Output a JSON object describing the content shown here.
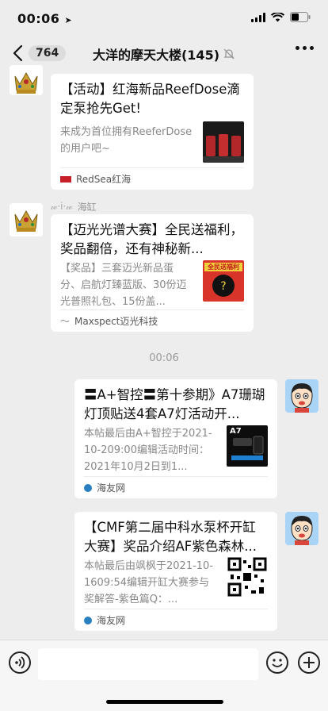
{
  "status_bar": {
    "time": "00:06"
  },
  "header": {
    "back_badge": "764",
    "title": "大洋的摩天大楼(145)"
  },
  "timestamp": "00:06",
  "messages": [
    {
      "title": "【活动】红海新品ReefDose滴定泵抢先Get!",
      "desc": "来成为首位拥有ReeferDose的用户吧~",
      "source": "RedSea红海"
    },
    {
      "nickname": "海缸",
      "title": "【迈光光谱大赛】全民送福利，奖品翻倍，还有神秘新...",
      "desc": "【奖品】三套迈光新品蛋分、启航灯臻蓝版、30份迈光普照礼包、15份盖...",
      "source": "Maxspect迈光科技",
      "thumb_text": "全民送福利"
    },
    {
      "title": "〓A+智控〓第十参期》A7珊瑚灯顶贴送4套A7灯活动开...",
      "desc": "本帖最后由A+智控于2021-10-209:00编辑活动时间：2021年10月2日到1...",
      "source": "海友网",
      "thumb_text": "A7"
    },
    {
      "title": "【CMF第二届中科水泵杯开缸大赛】奖品介绍AF紫色森林...",
      "desc": "本帖最后由飒枫于2021-10-1609:54编辑开缸大赛参与奖解答-紫色篇Q：...",
      "source": "海友网"
    }
  ]
}
